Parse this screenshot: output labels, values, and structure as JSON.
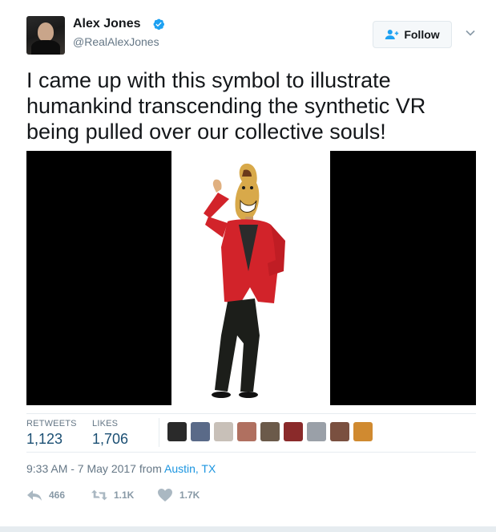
{
  "author": {
    "name": "Alex Jones",
    "handle": "@RealAlexJones",
    "verified": true
  },
  "follow_button": {
    "label": "Follow",
    "icon": "follow-person-plus-icon"
  },
  "menu_icon": "chevron-down-icon",
  "tweet": {
    "text": "I came up with this symbol to illustrate humankind transcending the synthetic VR being pulled over our collective souls!"
  },
  "stats": {
    "retweets_label": "RETWEETS",
    "retweets_value": "1,123",
    "likes_label": "LIKES",
    "likes_value": "1,706"
  },
  "liker_avatars": [
    "#2a2a2a",
    "#5a6a88",
    "#c8c0b8",
    "#b07060",
    "#6b5a4a",
    "#8a2a2a",
    "#9aa0a8",
    "#7a5040",
    "#d08a30"
  ],
  "timestamp": {
    "time_date": "9:33 AM - 7 May 2017 from ",
    "location": "Austin, TX"
  },
  "actions": {
    "reply_count": "466",
    "retweet_count": "1.1K",
    "like_count": "1.7K"
  },
  "colors": {
    "link": "#1b95e0",
    "stat_value": "#1b4f73",
    "muted": "#657786",
    "jacket": "#d2232a"
  }
}
